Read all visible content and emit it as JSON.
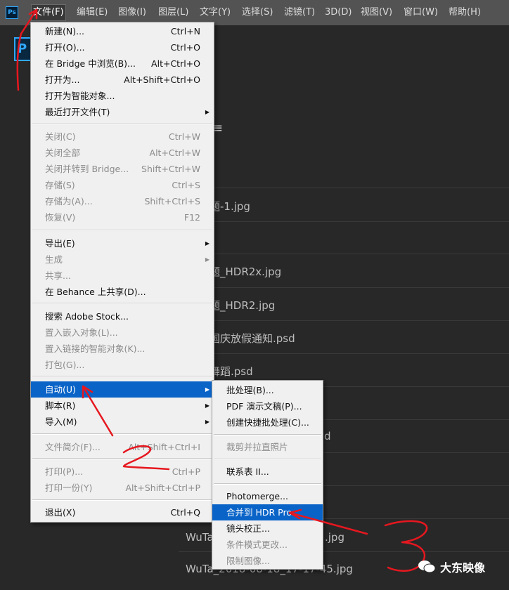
{
  "menubar": {
    "logo": "Ps",
    "items": [
      "文件(F)",
      "编辑(E)",
      "图像(I)",
      "图层(L)",
      "文字(Y)",
      "选择(S)",
      "滤镜(T)",
      "3D(D)",
      "视图(V)",
      "窗口(W)",
      "帮助(H)"
    ]
  },
  "home": {
    "logo": "P",
    "recent_icon": "≡",
    "recent_files": [
      "题-1.jpg",
      "题_HDR2x.jpg",
      "题_HDR2.jpg",
      "国庆放假通知.psd",
      "舞蹈.psd",
      "d",
      "WuTa_",
      "WuTa_2018-08-18_17-17-45.jpg"
    ],
    "recent_file_suffix": ".jpg"
  },
  "file_menu": {
    "items": [
      {
        "label": "新建(N)...",
        "shortcut": "Ctrl+N",
        "enabled": true
      },
      {
        "label": "打开(O)...",
        "shortcut": "Ctrl+O",
        "enabled": true
      },
      {
        "label": "在 Bridge 中浏览(B)...",
        "shortcut": "Alt+Ctrl+O",
        "enabled": true
      },
      {
        "label": "打开为...",
        "shortcut": "Alt+Shift+Ctrl+O",
        "enabled": true
      },
      {
        "label": "打开为智能对象...",
        "shortcut": "",
        "enabled": true
      },
      {
        "label": "最近打开文件(T)",
        "shortcut": "",
        "enabled": true,
        "submenu": true
      },
      {
        "label": "关闭(C)",
        "shortcut": "Ctrl+W",
        "enabled": false
      },
      {
        "label": "关闭全部",
        "shortcut": "Alt+Ctrl+W",
        "enabled": false
      },
      {
        "label": "关闭并转到 Bridge...",
        "shortcut": "Shift+Ctrl+W",
        "enabled": false
      },
      {
        "label": "存储(S)",
        "shortcut": "Ctrl+S",
        "enabled": false
      },
      {
        "label": "存储为(A)...",
        "shortcut": "Shift+Ctrl+S",
        "enabled": false
      },
      {
        "label": "恢复(V)",
        "shortcut": "F12",
        "enabled": false
      },
      {
        "label": "导出(E)",
        "shortcut": "",
        "enabled": true,
        "submenu": true
      },
      {
        "label": "生成",
        "shortcut": "",
        "enabled": false,
        "submenu": true
      },
      {
        "label": "共享...",
        "shortcut": "",
        "enabled": false
      },
      {
        "label": "在 Behance 上共享(D)...",
        "shortcut": "",
        "enabled": true
      },
      {
        "label": "搜索 Adobe Stock...",
        "shortcut": "",
        "enabled": true
      },
      {
        "label": "置入嵌入对象(L)...",
        "shortcut": "",
        "enabled": false
      },
      {
        "label": "置入链接的智能对象(K)...",
        "shortcut": "",
        "enabled": false
      },
      {
        "label": "打包(G)...",
        "shortcut": "",
        "enabled": false
      },
      {
        "label": "自动(U)",
        "shortcut": "",
        "enabled": true,
        "submenu": true,
        "highlighted": true
      },
      {
        "label": "脚本(R)",
        "shortcut": "",
        "enabled": true,
        "submenu": true
      },
      {
        "label": "导入(M)",
        "shortcut": "",
        "enabled": true,
        "submenu": true
      },
      {
        "label": "文件简介(F)...",
        "shortcut": "Alt+Shift+Ctrl+I",
        "enabled": false
      },
      {
        "label": "打印(P)...",
        "shortcut": "Ctrl+P",
        "enabled": false
      },
      {
        "label": "打印一份(Y)",
        "shortcut": "Alt+Shift+Ctrl+P",
        "enabled": false
      },
      {
        "label": "退出(X)",
        "shortcut": "Ctrl+Q",
        "enabled": true
      }
    ]
  },
  "automate_menu": {
    "items": [
      {
        "label": "批处理(B)...",
        "enabled": true
      },
      {
        "label": "PDF 演示文稿(P)...",
        "enabled": true
      },
      {
        "label": "创建快捷批处理(C)...",
        "enabled": true
      },
      {
        "label": "裁剪并拉直照片",
        "enabled": false
      },
      {
        "label": "联系表 II...",
        "enabled": true
      },
      {
        "label": "Photomerge...",
        "enabled": true
      },
      {
        "label": "合并到 HDR Pro...",
        "enabled": true,
        "highlighted": true
      },
      {
        "label": "镜头校正...",
        "enabled": true
      },
      {
        "label": "条件模式更改...",
        "enabled": false
      },
      {
        "label": "限制图像...",
        "enabled": false
      }
    ]
  },
  "icons": {
    "submenu_arrow": "▶"
  },
  "watermark": {
    "text": "大东映像"
  },
  "colors": {
    "highlight": "#0a64c8",
    "annotation": "#e6171f"
  }
}
